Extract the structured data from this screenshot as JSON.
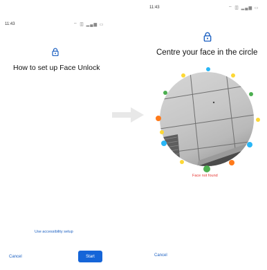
{
  "left_screen": {
    "status_time": "11:43",
    "status_icons": "⌔ ▥ ▂▄▆ ▭",
    "title": "How to set up Face Unlock",
    "accessibility_link": "Use accessibility setup",
    "cancel_label": "Cancel",
    "start_label": "Start"
  },
  "right_screen": {
    "status_time": "11:43",
    "status_icons": "⌔ ▥ ▂▄▆ ▭",
    "title": "Centre your face in the circle",
    "status_message": "Face not found",
    "cancel_label": "Cancel"
  },
  "icons": {
    "lock": "lock-icon",
    "arrow": "right-arrow-icon"
  },
  "colors": {
    "accent": "#1565d8",
    "link": "#1a5fc1",
    "error": "#e53935",
    "dot_green": "#4caf50",
    "dot_yellow": "#fdd835",
    "dot_orange": "#ff7a1a",
    "dot_cyan": "#29b6f6"
  }
}
